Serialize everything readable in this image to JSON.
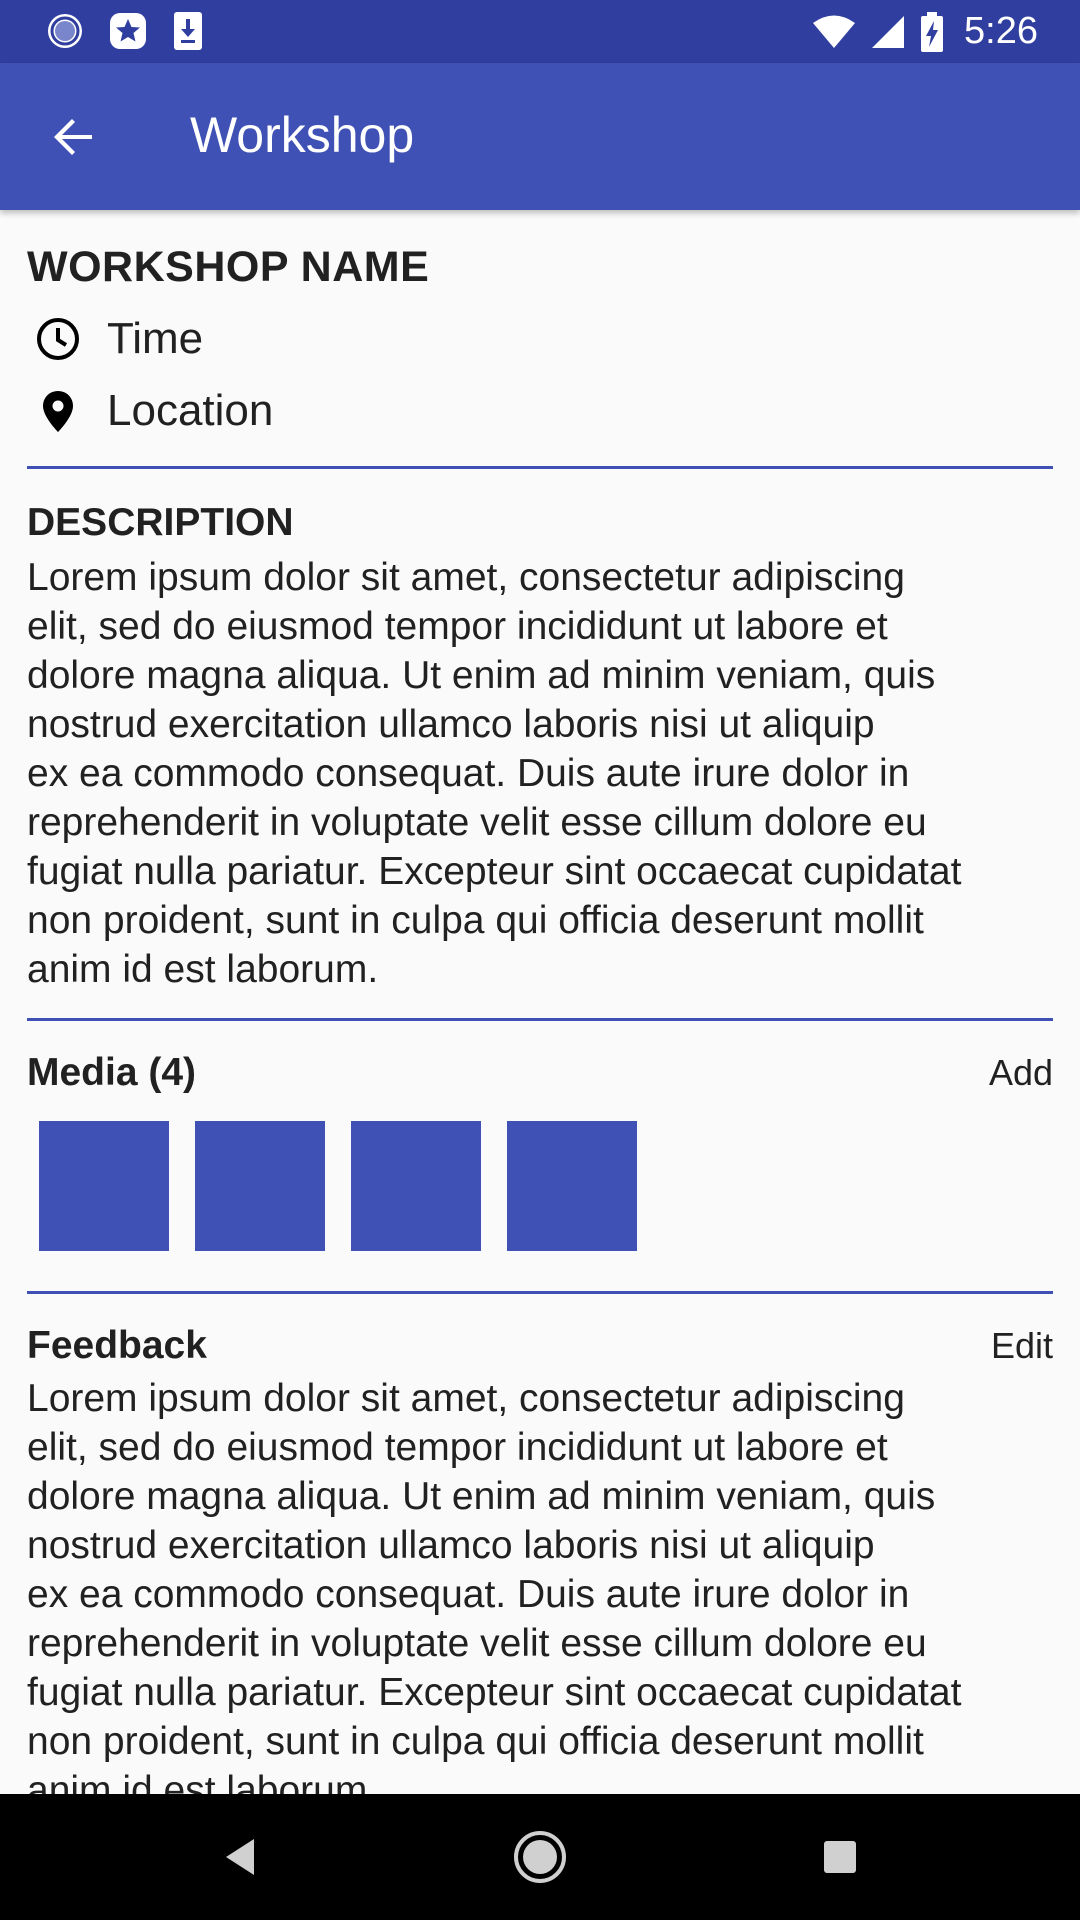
{
  "status_bar": {
    "time": "5:26",
    "left_icons": [
      "circle-notification-icon",
      "star-badge-icon",
      "download-icon"
    ],
    "right_icons": [
      "wifi-icon",
      "cell-signal-icon",
      "battery-charging-icon"
    ]
  },
  "app_bar": {
    "title": "Workshop",
    "back_icon": "arrow-back-icon"
  },
  "workshop": {
    "name": "WORKSHOP NAME",
    "time_label": "Time",
    "location_label": "Location"
  },
  "description": {
    "heading": "DESCRIPTION",
    "lines": [
      "Lorem ipsum dolor sit amet, consectetur adipiscing",
      "elit, sed do eiusmod tempor incididunt ut labore et",
      "dolore magna aliqua. Ut enim ad minim veniam, quis",
      "nostrud exercitation ullamco laboris nisi ut aliquip",
      "ex ea commodo consequat. Duis aute irure dolor in",
      "reprehenderit in voluptate velit esse cillum dolore eu",
      "fugiat nulla pariatur. Excepteur sint occaecat cupidatat",
      "non proident, sunt in culpa qui officia deserunt mollit",
      "anim id est laborum."
    ]
  },
  "media": {
    "heading": "Media (4)",
    "action": "Add",
    "count": 4
  },
  "feedback": {
    "heading": "Feedback",
    "action": "Edit",
    "lines": [
      "Lorem ipsum dolor sit amet, consectetur adipiscing",
      "elit, sed do eiusmod tempor incididunt ut labore et",
      "dolore magna aliqua. Ut enim ad minim veniam, quis",
      "nostrud exercitation ullamco laboris nisi ut aliquip",
      "ex ea commodo consequat. Duis aute irure dolor in",
      "reprehenderit in voluptate velit esse cillum dolore eu",
      "fugiat nulla pariatur. Excepteur sint occaecat cupidatat",
      "non proident, sunt in culpa qui officia deserunt mollit",
      "anim id est laborum."
    ]
  },
  "nav_bar": {
    "buttons": [
      "back-triangle-icon",
      "home-circle-icon",
      "recents-square-icon"
    ]
  },
  "colors": {
    "primary": "#3f51b5",
    "primary_dark": "#303f9f",
    "background": "#fafafa",
    "text": "#212121"
  }
}
